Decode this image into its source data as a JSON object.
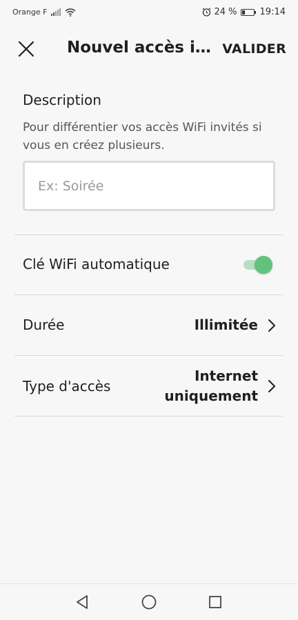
{
  "status_bar": {
    "carrier": "Orange F",
    "battery_percent": "24 %",
    "battery_level": 0.24,
    "time": "19:14"
  },
  "header": {
    "title": "Nouvel accès in...",
    "validate_label": "VALIDER"
  },
  "description": {
    "label": "Description",
    "help": "Pour différentier vos accès WiFi invités si vous en créez plusieurs.",
    "value": "",
    "placeholder": "Ex: Soirée"
  },
  "auto_key": {
    "label": "Clé WiFi automatique",
    "enabled": true
  },
  "duration": {
    "label": "Durée",
    "value": "Illimitée"
  },
  "access_type": {
    "label": "Type d'accès",
    "value_line1": "Internet",
    "value_line2": "uniquement"
  },
  "colors": {
    "toggle_on": "#62c27c",
    "toggle_track": "#b5e0c1",
    "background": "#f7f7f7"
  },
  "icons": [
    "signal-icon",
    "wifi-icon",
    "alarm-icon",
    "battery-icon",
    "close-icon",
    "chevron-right-icon",
    "back-nav-icon",
    "home-nav-icon",
    "recents-nav-icon"
  ]
}
